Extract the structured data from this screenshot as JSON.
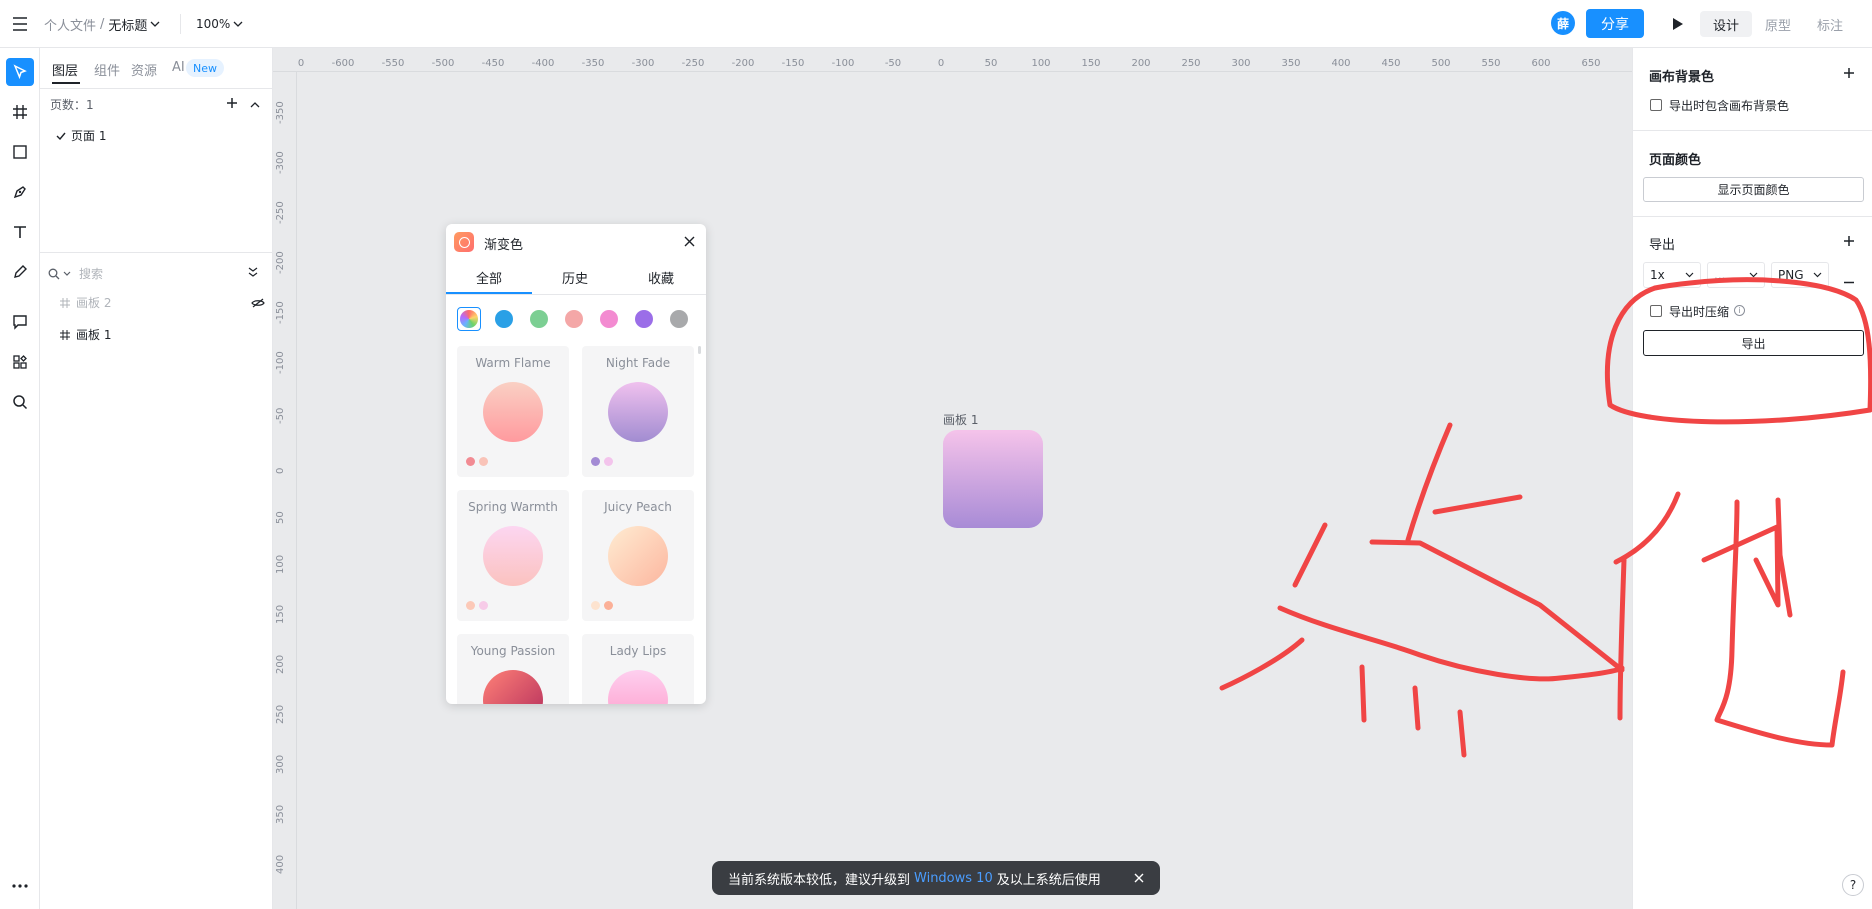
{
  "topbar": {
    "menu_icon": "hamburger-icon",
    "breadcrumb_parent": "个人文件",
    "breadcrumb_sep": "/",
    "file_title": "无标题",
    "zoom": "100%",
    "avatar_text": "薛",
    "share_label": "分享",
    "play_icon": "play-icon",
    "modes": [
      "设计",
      "原型",
      "标注"
    ],
    "active_mode": "设计"
  },
  "tools": [
    "select-icon",
    "frame-icon",
    "rectangle-icon",
    "pen-icon",
    "text-icon",
    "pencil-icon",
    "comment-icon",
    "plugins-icon",
    "search-icon",
    "more-icon"
  ],
  "left_panel": {
    "tabs": [
      "图层",
      "组件",
      "资源",
      "AI"
    ],
    "new_badge": "New",
    "pages_label": "页数：1",
    "pages": [
      {
        "name": "页面 1",
        "checked": true
      }
    ],
    "search_placeholder": "搜索",
    "layers": [
      {
        "name": "画板 2",
        "hidden": true
      },
      {
        "name": "画板 1",
        "hidden": false
      }
    ]
  },
  "ruler": {
    "top": [
      "0",
      "-600",
      "-550",
      "-500",
      "-450",
      "-400",
      "-350",
      "-300",
      "-250",
      "-200",
      "-150",
      "-100",
      "-50",
      "0",
      "50",
      "100",
      "150",
      "200",
      "250",
      "300",
      "350",
      "400",
      "450",
      "500",
      "550",
      "600",
      "650"
    ],
    "left": [
      "-350",
      "-300",
      "-250",
      "-200",
      "-150",
      "-100",
      "-50",
      "0",
      "50",
      "100",
      "150",
      "200",
      "250",
      "300",
      "350",
      "400"
    ]
  },
  "gradient_picker": {
    "title": "渐变色",
    "tabs": [
      "全部",
      "历史",
      "收藏"
    ],
    "active_tab": "全部",
    "swatch_colors": [
      "#ffffff",
      "#2aa0e6",
      "#7ccf93",
      "#f4a7a7",
      "#f38bd1",
      "#9b6ee8",
      "#a8a9ab"
    ],
    "cards": [
      {
        "name": "Warm Flame",
        "from": "#ff9a9e",
        "to": "#fad0c4",
        "dots": [
          "#f28b93",
          "#f9c3b8"
        ]
      },
      {
        "name": "Night Fade",
        "from": "#f0c1ee",
        "to": "#a18cd1",
        "dots": [
          "#a38bd4",
          "#f3c4ec"
        ]
      },
      {
        "name": "Spring Warmth",
        "from": "#fcd6f1",
        "to": "#fbc2bf",
        "dots": [
          "#fcc9b8",
          "#f7cbe8"
        ]
      },
      {
        "name": "Juicy Peach",
        "from": "#ffecd2",
        "to": "#fcb69f",
        "dots": [
          "#fde3cf",
          "#fbb098"
        ]
      },
      {
        "name": "Young Passion",
        "from": "#ff8177",
        "to": "#b12a5b",
        "dots": []
      },
      {
        "name": "Lady Lips",
        "from": "#ff9a9e",
        "to": "#fecfef",
        "dots": []
      }
    ]
  },
  "canvas": {
    "artboard_label": "画板 1"
  },
  "right_panel": {
    "canvas_bg_title": "画布背景色",
    "include_bg_label": "导出时包含画布背景色",
    "page_color_title": "页面颜色",
    "show_page_color": "显示页面颜色",
    "export_title": "导出",
    "scale": "1x",
    "suffix": "...",
    "format": "PNG",
    "compress_label": "导出时压缩",
    "export_button": "导出"
  },
  "toast": {
    "text_before": "当前系统版本较低，建议升级到",
    "highlight": "Windows 10",
    "text_after": "及以上系统后使用"
  },
  "help_icon": "?"
}
